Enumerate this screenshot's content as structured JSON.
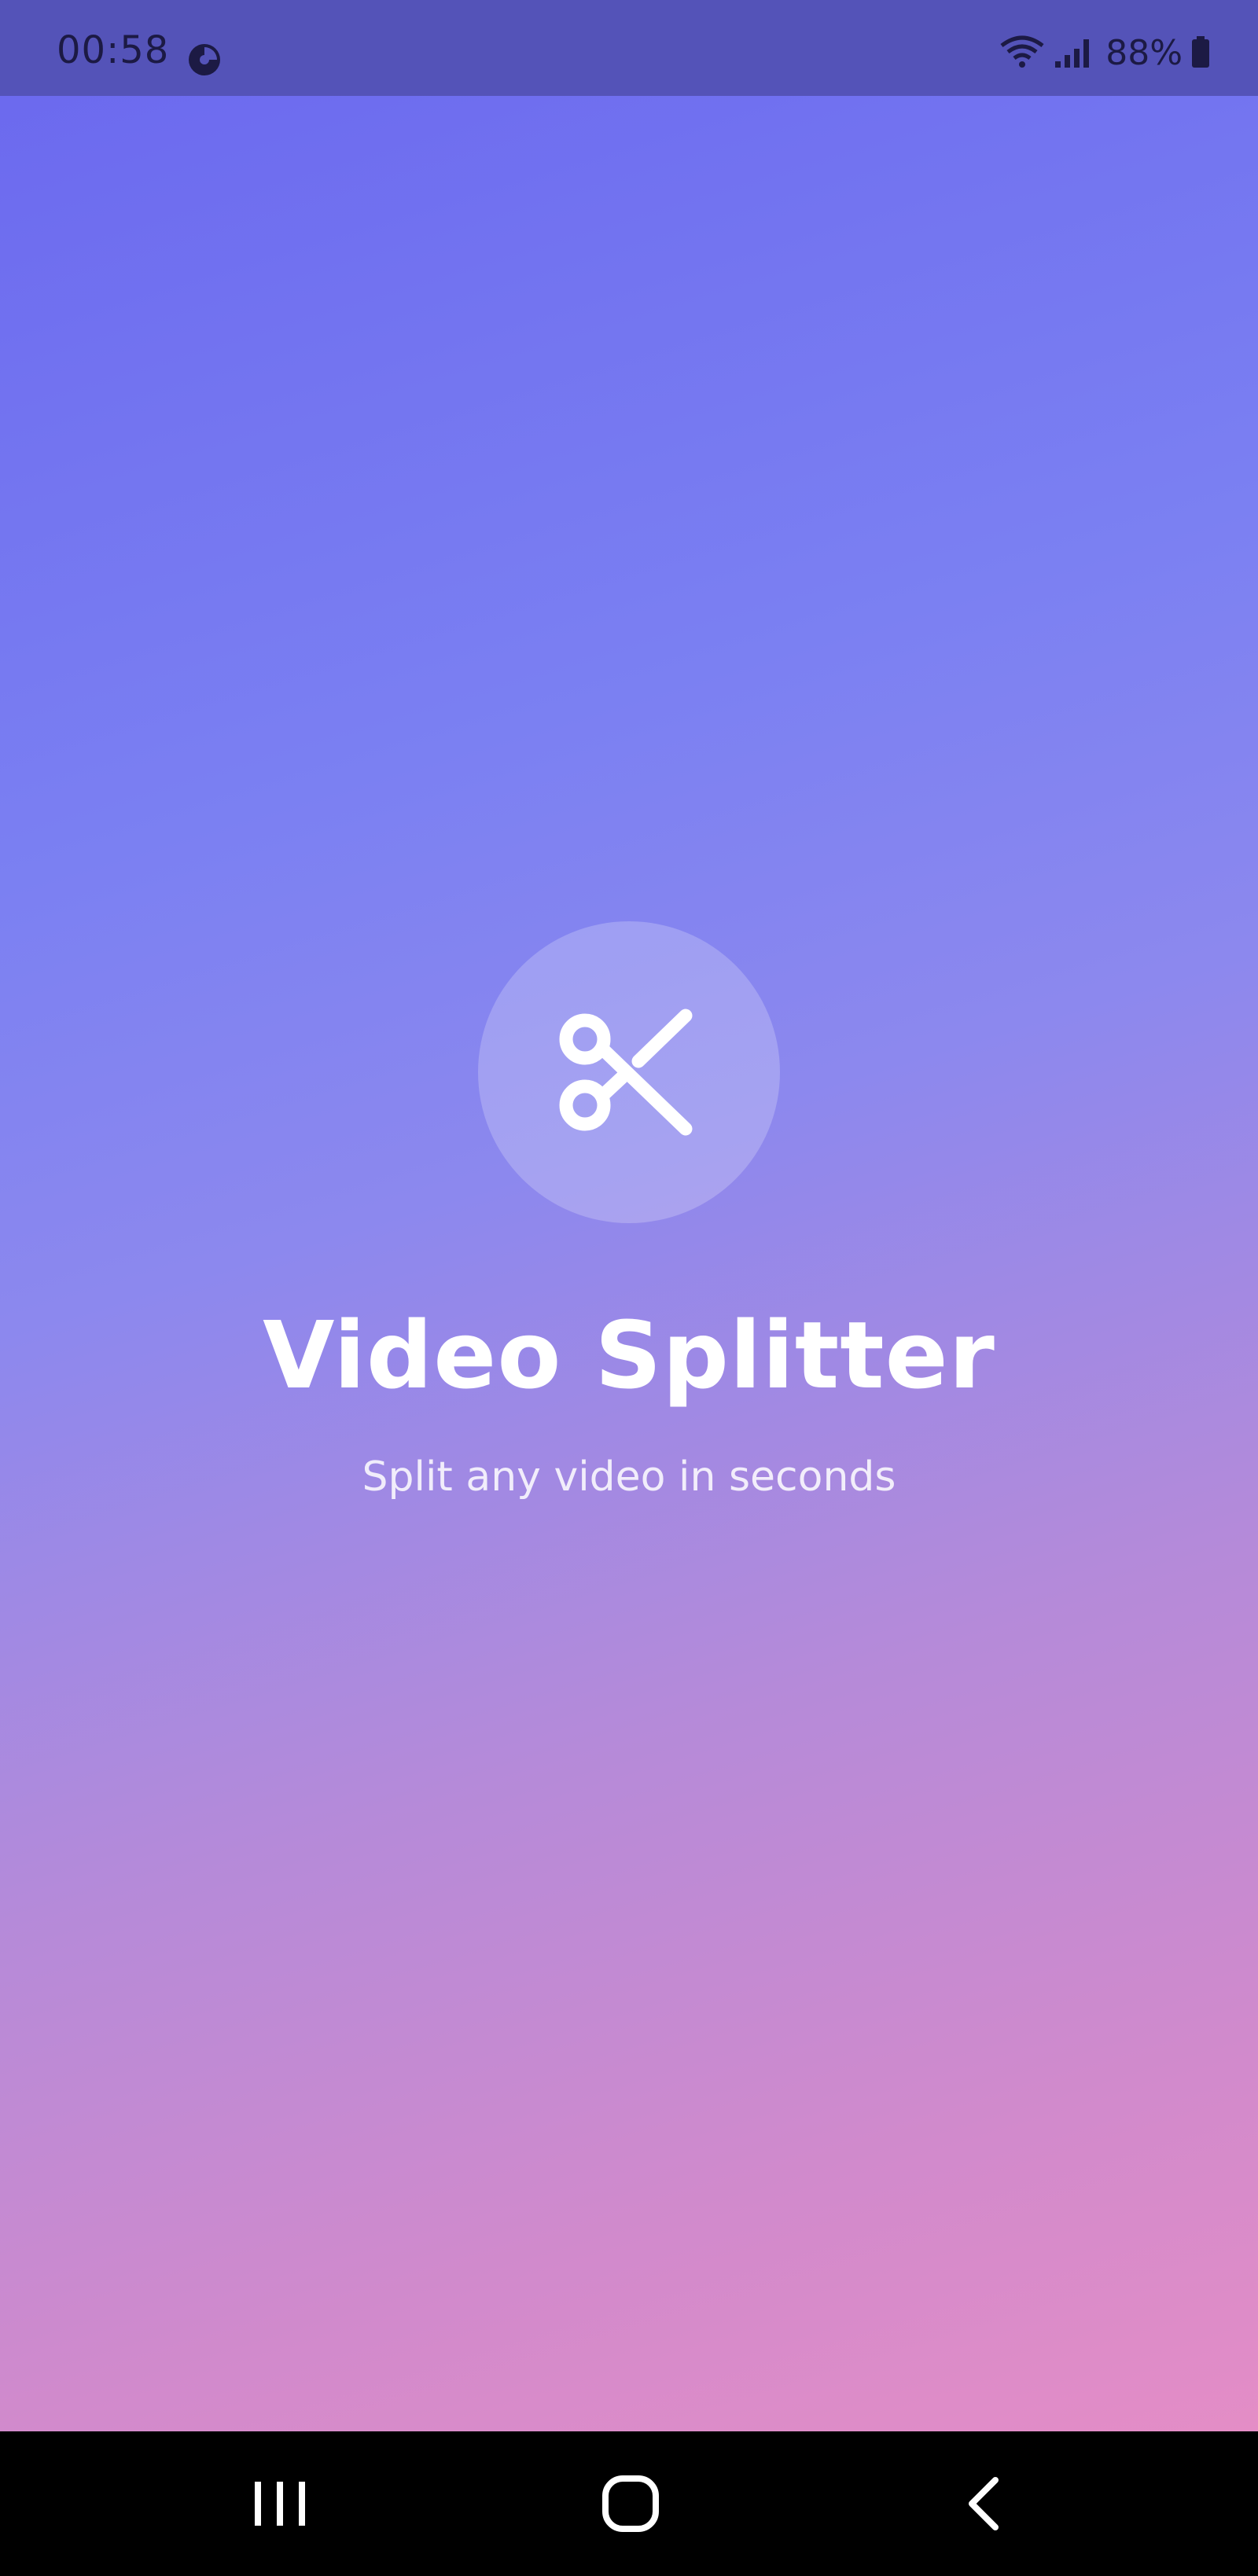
{
  "status_bar": {
    "time": "00:58",
    "battery": "88%",
    "icons": [
      "data-saver-icon",
      "wifi-icon",
      "signal-icon",
      "battery-icon"
    ]
  },
  "app": {
    "title": "Video Splitter",
    "subtitle": "Split any video in seconds",
    "logo_icon": "scissors-icon"
  },
  "navigation": {
    "buttons": [
      "recents-icon",
      "home-icon",
      "back-icon"
    ]
  },
  "colors": {
    "gradient_top": "#6a67ee",
    "gradient_bottom": "#eb8ec4",
    "status_bar": "#5453b8",
    "nav_bar": "#000000"
  }
}
